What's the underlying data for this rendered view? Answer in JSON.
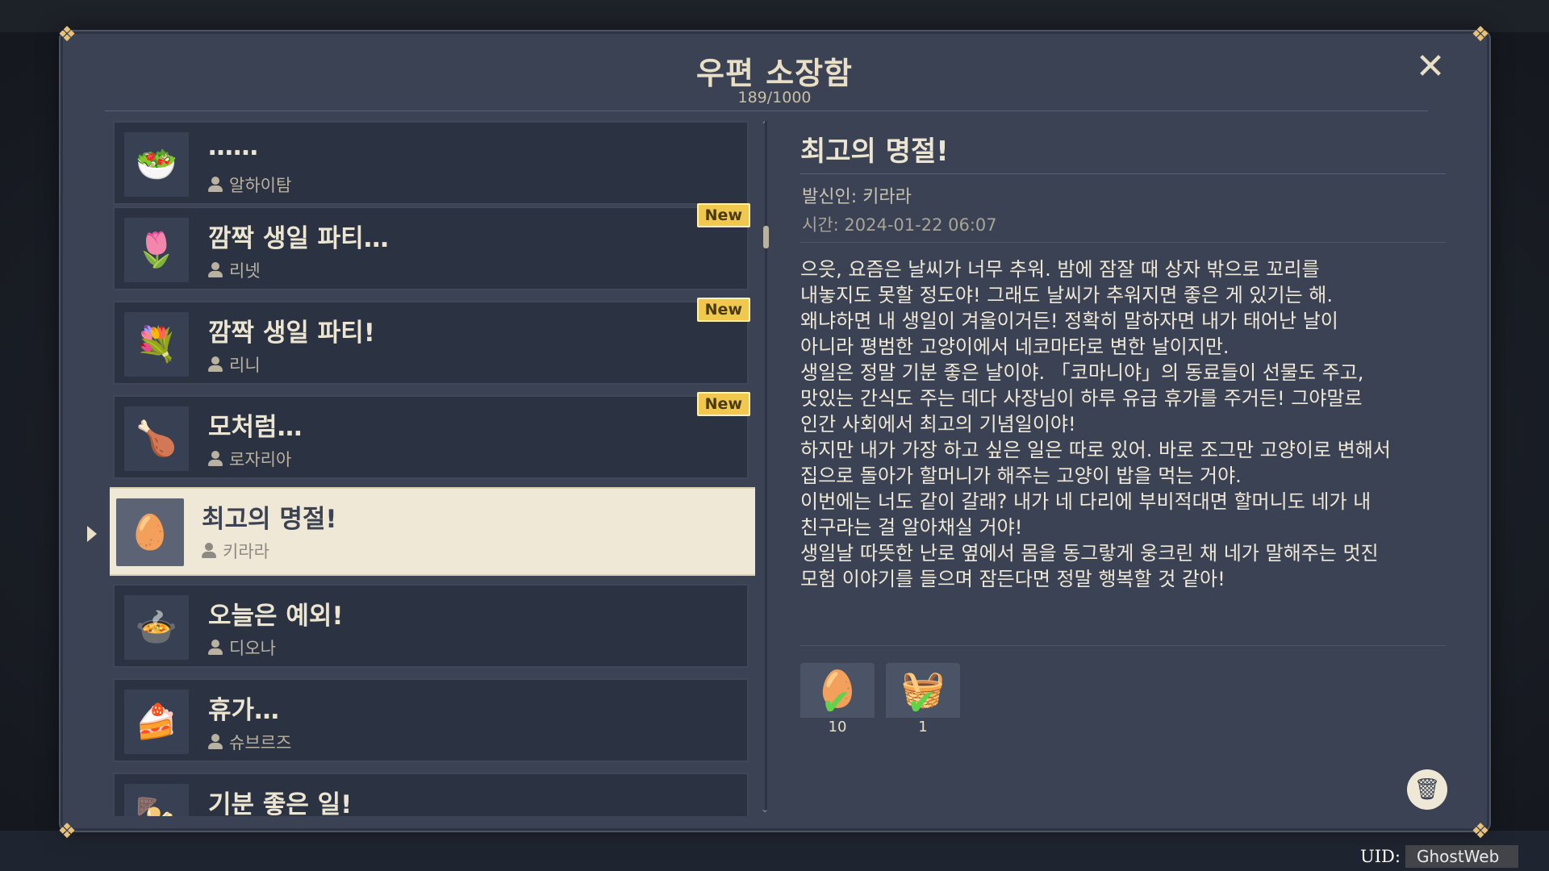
{
  "header": {
    "title": "우편 소장함",
    "count": "189/1000"
  },
  "mail_list": [
    {
      "title": "……",
      "sender": "알하이탐",
      "new": false,
      "thumb_icon": "dish-icon",
      "thumb_glyph": "🥗"
    },
    {
      "title": "깜짝 생일 파티…",
      "sender": "리넷",
      "new": true,
      "thumb_icon": "flower-icon",
      "thumb_glyph": "🌷"
    },
    {
      "title": "깜짝 생일 파티!",
      "sender": "리니",
      "new": true,
      "thumb_icon": "flower-icon",
      "thumb_glyph": "💐"
    },
    {
      "title": "모처럼…",
      "sender": "로자리아",
      "new": true,
      "thumb_icon": "roast-icon",
      "thumb_glyph": "🍗"
    },
    {
      "title": "최고의 명절!",
      "sender": "키라라",
      "new": false,
      "thumb_icon": "egg-icon",
      "thumb_glyph": "🥚"
    },
    {
      "title": "오늘은 예외!",
      "sender": "디오나",
      "new": false,
      "thumb_icon": "dish-icon",
      "thumb_glyph": "🍲"
    },
    {
      "title": "휴가…",
      "sender": "슈브르즈",
      "new": false,
      "thumb_icon": "cake-icon",
      "thumb_glyph": "🍰"
    },
    {
      "title": "기분 좋은 일!",
      "sender": "",
      "new": false,
      "thumb_icon": "dish-icon",
      "thumb_glyph": "🍢"
    }
  ],
  "new_badge_label": "New",
  "detail": {
    "title": "최고의 명절!",
    "sender": "발신인: 키라라",
    "time": "시간: 2024-01-22 06:07",
    "body": "으읏, 요즘은 날씨가 너무 추워. 밤에 잠잘 때 상자 밖으로 꼬리를\n내놓지도 못할 정도야! 그래도 날씨가 추워지면 좋은 게 있기는 해.\n왜냐하면 내 생일이 겨울이거든! 정확히 말하자면 내가 태어난 날이\n아니라 평범한 고양이에서 네코마타로 변한 날이지만.\n생일은 정말 기분 좋은 날이야. 「코마니야」의 동료들이 선물도 주고,\n맛있는 간식도 주는 데다 사장님이 하루 유급 휴가를 주거든! 그야말로\n인간 사회에서 최고의 기념일이야!\n하지만 내가 가장 하고 싶은 일은 따로 있어. 바로 조그만 고양이로 변해서\n집으로 돌아가 할머니가 해주는 고양이 밥을 먹는 거야.\n이번에는 너도 같이 갈래? 내가 네 다리에 부비적대면 할머니도 네가 내\n친구라는 걸 알아채실 거야!\n생일날 따뜻한 난로 옆에서 몸을 동그랗게 웅크린 채 네가 말해주는 멋진\n모험 이야기를 들으며 잠든다면 정말 행복할 것 같아!"
  },
  "rewards": [
    {
      "qty": "10",
      "icon": "egg-icon",
      "glyph": "🥚",
      "claimed": true
    },
    {
      "qty": "1",
      "icon": "treasure-chest-icon",
      "glyph": "🧺",
      "claimed": true
    }
  ],
  "footer": {
    "uid_label": "UID:",
    "uid_value": "GhostWeb"
  },
  "colors": {
    "panel": "#3a4253",
    "item": "#2b3342",
    "selected": "#efe8d6",
    "badge": "#f1c84e",
    "check": "#5fd34a"
  }
}
